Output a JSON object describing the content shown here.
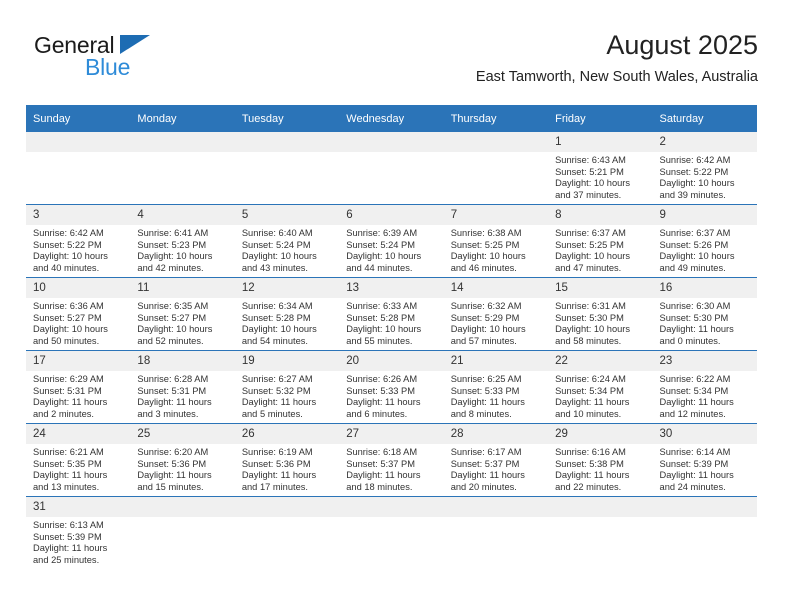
{
  "brand": {
    "name_part1": "General",
    "name_part2": "Blue",
    "flag_icon": "blue-triangle-flag"
  },
  "header": {
    "title": "August 2025",
    "subtitle": "East Tamworth, New South Wales, Australia"
  },
  "colors": {
    "header_blue": "#2b74b8",
    "daynum_gray": "#f0f0f0",
    "logo_blue": "#2e8bd8",
    "text": "#333333"
  },
  "weekday_headers": [
    "Sunday",
    "Monday",
    "Tuesday",
    "Wednesday",
    "Thursday",
    "Friday",
    "Saturday"
  ],
  "labels": {
    "sunrise_prefix": "Sunrise:",
    "sunset_prefix": "Sunset:",
    "daylight_prefix": "Daylight:"
  },
  "weeks": [
    [
      {
        "day": "",
        "empty": true,
        "line1": "",
        "line2": "",
        "line3": "",
        "line4": ""
      },
      {
        "day": "",
        "empty": true,
        "line1": "",
        "line2": "",
        "line3": "",
        "line4": ""
      },
      {
        "day": "",
        "empty": true,
        "line1": "",
        "line2": "",
        "line3": "",
        "line4": ""
      },
      {
        "day": "",
        "empty": true,
        "line1": "",
        "line2": "",
        "line3": "",
        "line4": ""
      },
      {
        "day": "",
        "empty": true,
        "line1": "",
        "line2": "",
        "line3": "",
        "line4": ""
      },
      {
        "day": "1",
        "empty": false,
        "line1": "Sunrise: 6:43 AM",
        "line2": "Sunset: 5:21 PM",
        "line3": "Daylight: 10 hours",
        "line4": "and 37 minutes."
      },
      {
        "day": "2",
        "empty": false,
        "line1": "Sunrise: 6:42 AM",
        "line2": "Sunset: 5:22 PM",
        "line3": "Daylight: 10 hours",
        "line4": "and 39 minutes."
      }
    ],
    [
      {
        "day": "3",
        "empty": false,
        "line1": "Sunrise: 6:42 AM",
        "line2": "Sunset: 5:22 PM",
        "line3": "Daylight: 10 hours",
        "line4": "and 40 minutes."
      },
      {
        "day": "4",
        "empty": false,
        "line1": "Sunrise: 6:41 AM",
        "line2": "Sunset: 5:23 PM",
        "line3": "Daylight: 10 hours",
        "line4": "and 42 minutes."
      },
      {
        "day": "5",
        "empty": false,
        "line1": "Sunrise: 6:40 AM",
        "line2": "Sunset: 5:24 PM",
        "line3": "Daylight: 10 hours",
        "line4": "and 43 minutes."
      },
      {
        "day": "6",
        "empty": false,
        "line1": "Sunrise: 6:39 AM",
        "line2": "Sunset: 5:24 PM",
        "line3": "Daylight: 10 hours",
        "line4": "and 44 minutes."
      },
      {
        "day": "7",
        "empty": false,
        "line1": "Sunrise: 6:38 AM",
        "line2": "Sunset: 5:25 PM",
        "line3": "Daylight: 10 hours",
        "line4": "and 46 minutes."
      },
      {
        "day": "8",
        "empty": false,
        "line1": "Sunrise: 6:37 AM",
        "line2": "Sunset: 5:25 PM",
        "line3": "Daylight: 10 hours",
        "line4": "and 47 minutes."
      },
      {
        "day": "9",
        "empty": false,
        "line1": "Sunrise: 6:37 AM",
        "line2": "Sunset: 5:26 PM",
        "line3": "Daylight: 10 hours",
        "line4": "and 49 minutes."
      }
    ],
    [
      {
        "day": "10",
        "empty": false,
        "line1": "Sunrise: 6:36 AM",
        "line2": "Sunset: 5:27 PM",
        "line3": "Daylight: 10 hours",
        "line4": "and 50 minutes."
      },
      {
        "day": "11",
        "empty": false,
        "line1": "Sunrise: 6:35 AM",
        "line2": "Sunset: 5:27 PM",
        "line3": "Daylight: 10 hours",
        "line4": "and 52 minutes."
      },
      {
        "day": "12",
        "empty": false,
        "line1": "Sunrise: 6:34 AM",
        "line2": "Sunset: 5:28 PM",
        "line3": "Daylight: 10 hours",
        "line4": "and 54 minutes."
      },
      {
        "day": "13",
        "empty": false,
        "line1": "Sunrise: 6:33 AM",
        "line2": "Sunset: 5:28 PM",
        "line3": "Daylight: 10 hours",
        "line4": "and 55 minutes."
      },
      {
        "day": "14",
        "empty": false,
        "line1": "Sunrise: 6:32 AM",
        "line2": "Sunset: 5:29 PM",
        "line3": "Daylight: 10 hours",
        "line4": "and 57 minutes."
      },
      {
        "day": "15",
        "empty": false,
        "line1": "Sunrise: 6:31 AM",
        "line2": "Sunset: 5:30 PM",
        "line3": "Daylight: 10 hours",
        "line4": "and 58 minutes."
      },
      {
        "day": "16",
        "empty": false,
        "line1": "Sunrise: 6:30 AM",
        "line2": "Sunset: 5:30 PM",
        "line3": "Daylight: 11 hours",
        "line4": "and 0 minutes."
      }
    ],
    [
      {
        "day": "17",
        "empty": false,
        "line1": "Sunrise: 6:29 AM",
        "line2": "Sunset: 5:31 PM",
        "line3": "Daylight: 11 hours",
        "line4": "and 2 minutes."
      },
      {
        "day": "18",
        "empty": false,
        "line1": "Sunrise: 6:28 AM",
        "line2": "Sunset: 5:31 PM",
        "line3": "Daylight: 11 hours",
        "line4": "and 3 minutes."
      },
      {
        "day": "19",
        "empty": false,
        "line1": "Sunrise: 6:27 AM",
        "line2": "Sunset: 5:32 PM",
        "line3": "Daylight: 11 hours",
        "line4": "and 5 minutes."
      },
      {
        "day": "20",
        "empty": false,
        "line1": "Sunrise: 6:26 AM",
        "line2": "Sunset: 5:33 PM",
        "line3": "Daylight: 11 hours",
        "line4": "and 6 minutes."
      },
      {
        "day": "21",
        "empty": false,
        "line1": "Sunrise: 6:25 AM",
        "line2": "Sunset: 5:33 PM",
        "line3": "Daylight: 11 hours",
        "line4": "and 8 minutes."
      },
      {
        "day": "22",
        "empty": false,
        "line1": "Sunrise: 6:24 AM",
        "line2": "Sunset: 5:34 PM",
        "line3": "Daylight: 11 hours",
        "line4": "and 10 minutes."
      },
      {
        "day": "23",
        "empty": false,
        "line1": "Sunrise: 6:22 AM",
        "line2": "Sunset: 5:34 PM",
        "line3": "Daylight: 11 hours",
        "line4": "and 12 minutes."
      }
    ],
    [
      {
        "day": "24",
        "empty": false,
        "line1": "Sunrise: 6:21 AM",
        "line2": "Sunset: 5:35 PM",
        "line3": "Daylight: 11 hours",
        "line4": "and 13 minutes."
      },
      {
        "day": "25",
        "empty": false,
        "line1": "Sunrise: 6:20 AM",
        "line2": "Sunset: 5:36 PM",
        "line3": "Daylight: 11 hours",
        "line4": "and 15 minutes."
      },
      {
        "day": "26",
        "empty": false,
        "line1": "Sunrise: 6:19 AM",
        "line2": "Sunset: 5:36 PM",
        "line3": "Daylight: 11 hours",
        "line4": "and 17 minutes."
      },
      {
        "day": "27",
        "empty": false,
        "line1": "Sunrise: 6:18 AM",
        "line2": "Sunset: 5:37 PM",
        "line3": "Daylight: 11 hours",
        "line4": "and 18 minutes."
      },
      {
        "day": "28",
        "empty": false,
        "line1": "Sunrise: 6:17 AM",
        "line2": "Sunset: 5:37 PM",
        "line3": "Daylight: 11 hours",
        "line4": "and 20 minutes."
      },
      {
        "day": "29",
        "empty": false,
        "line1": "Sunrise: 6:16 AM",
        "line2": "Sunset: 5:38 PM",
        "line3": "Daylight: 11 hours",
        "line4": "and 22 minutes."
      },
      {
        "day": "30",
        "empty": false,
        "line1": "Sunrise: 6:14 AM",
        "line2": "Sunset: 5:39 PM",
        "line3": "Daylight: 11 hours",
        "line4": "and 24 minutes."
      }
    ],
    [
      {
        "day": "31",
        "empty": false,
        "line1": "Sunrise: 6:13 AM",
        "line2": "Sunset: 5:39 PM",
        "line3": "Daylight: 11 hours",
        "line4": "and 25 minutes."
      },
      {
        "day": "",
        "empty": true,
        "line1": "",
        "line2": "",
        "line3": "",
        "line4": ""
      },
      {
        "day": "",
        "empty": true,
        "line1": "",
        "line2": "",
        "line3": "",
        "line4": ""
      },
      {
        "day": "",
        "empty": true,
        "line1": "",
        "line2": "",
        "line3": "",
        "line4": ""
      },
      {
        "day": "",
        "empty": true,
        "line1": "",
        "line2": "",
        "line3": "",
        "line4": ""
      },
      {
        "day": "",
        "empty": true,
        "line1": "",
        "line2": "",
        "line3": "",
        "line4": ""
      },
      {
        "day": "",
        "empty": true,
        "line1": "",
        "line2": "",
        "line3": "",
        "line4": ""
      }
    ]
  ]
}
